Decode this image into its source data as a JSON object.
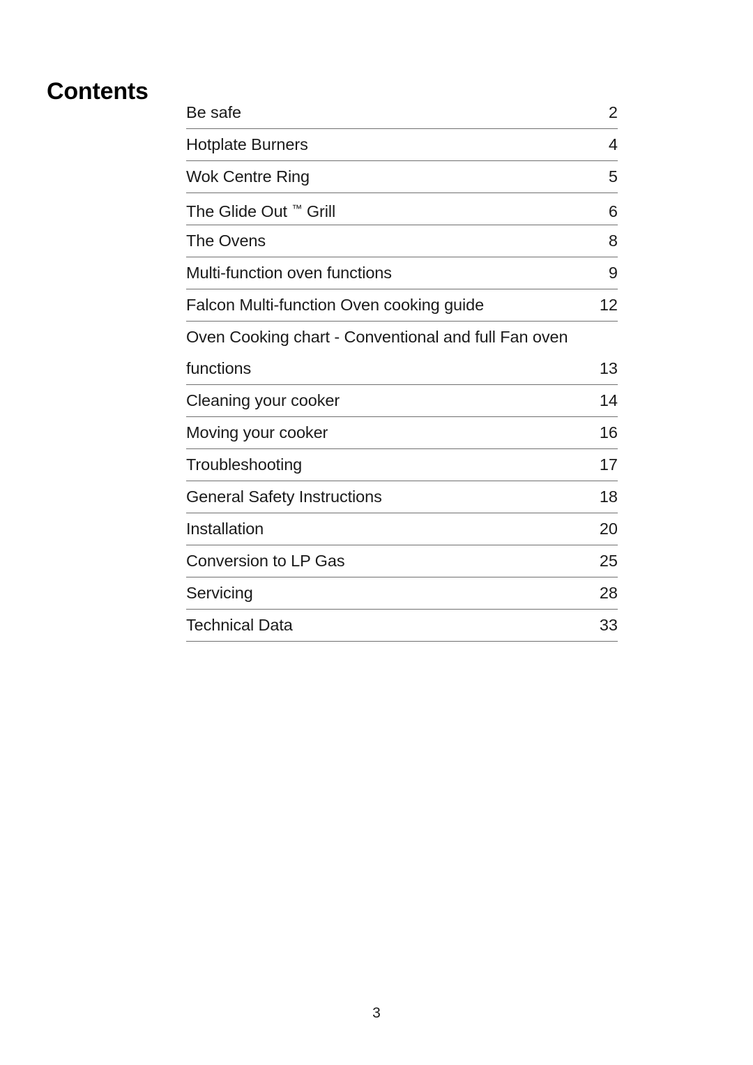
{
  "document": {
    "title": "Contents",
    "footer_page_number": "3",
    "rule_color": "#6f6f6f"
  },
  "toc": {
    "entries": [
      {
        "label": "Be safe",
        "page": "2",
        "lines": [
          "Be safe"
        ]
      },
      {
        "label": "Hotplate Burners",
        "page": "4",
        "lines": [
          "Hotplate Burners"
        ]
      },
      {
        "label": "Wok Centre Ring",
        "page": "5",
        "lines": [
          "Wok Centre Ring"
        ]
      },
      {
        "label": "The Glide Out ™ Grill",
        "page": "6",
        "lines": [
          "The Glide Out ™ Grill"
        ],
        "trademark": true,
        "label_before_tm": "The Glide Out ",
        "tm_symbol": "™",
        "label_after_tm": " Grill"
      },
      {
        "label": "The Ovens",
        "page": "8",
        "lines": [
          "The Ovens"
        ]
      },
      {
        "label": "Multi-function oven functions",
        "page": "9",
        "lines": [
          "Multi-function oven functions"
        ]
      },
      {
        "label": "Falcon Multi-function Oven cooking guide",
        "page": "12",
        "lines": [
          "Falcon Multi-function Oven cooking guide"
        ]
      },
      {
        "label": "Oven Cooking chart - Conventional and full Fan oven functions",
        "page": "13",
        "lines": [
          "Oven Cooking chart - Conventional and full Fan oven",
          "functions"
        ]
      },
      {
        "label": "Cleaning your cooker",
        "page": "14",
        "lines": [
          "Cleaning your cooker"
        ]
      },
      {
        "label": "Moving your cooker",
        "page": "16",
        "lines": [
          "Moving your cooker"
        ]
      },
      {
        "label": "Troubleshooting",
        "page": "17",
        "lines": [
          "Troubleshooting"
        ]
      },
      {
        "label": "General Safety Instructions",
        "page": "18",
        "lines": [
          "General Safety Instructions"
        ]
      },
      {
        "label": "Installation",
        "page": "20",
        "lines": [
          "Installation"
        ]
      },
      {
        "label": "Conversion to LP Gas",
        "page": "25",
        "lines": [
          "Conversion to LP Gas"
        ]
      },
      {
        "label": "Servicing",
        "page": "28",
        "lines": [
          "Servicing"
        ]
      },
      {
        "label": "Technical Data",
        "page": "33",
        "lines": [
          "Technical Data"
        ]
      }
    ]
  }
}
